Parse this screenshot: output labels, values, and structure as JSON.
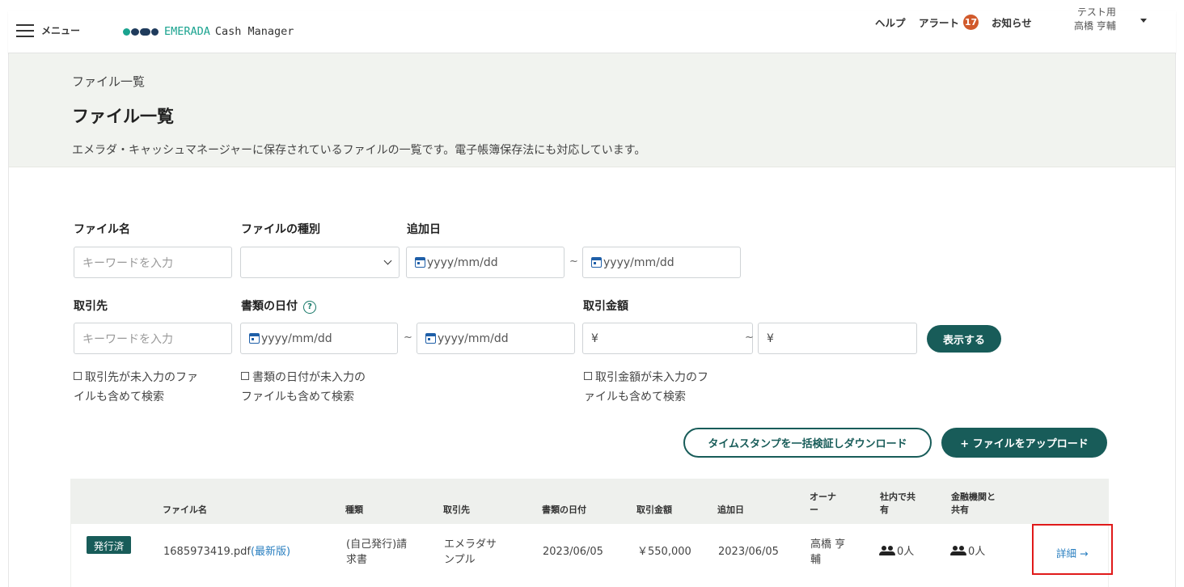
{
  "header": {
    "menu_label": "メニュー",
    "brand": "EMERADA",
    "product": "Cash Manager",
    "help": "ヘルプ",
    "alert": "アラート",
    "alert_count": "17",
    "news": "お知らせ",
    "user_org": "テスト用",
    "user_name": "高橋 亨輔"
  },
  "page": {
    "breadcrumb": "ファイル一覧",
    "title": "ファイル一覧",
    "description": "エメラダ・キャッシュマネージャーに保存されているファイルの一覧です。電子帳簿保存法にも対応しています。"
  },
  "filters": {
    "file_name_label": "ファイル名",
    "file_name_placeholder": "キーワードを入力",
    "file_type_label": "ファイルの種別",
    "added_date_label": "追加日",
    "date_placeholder": "yyyy/mm/dd",
    "tilde": "~",
    "partner_label": "取引先",
    "partner_placeholder": "キーワードを入力",
    "doc_date_label": "書類の日付",
    "help_symbol": "?",
    "amount_label": "取引金額",
    "yen": "¥",
    "show_button": "表示する",
    "chk_partner_line1": "取引先が未入力のファ",
    "chk_partner_line2": "イルも含めて検索",
    "chk_docdate_line1": "書類の日付が未入力の",
    "chk_docdate_line2": "ファイルも含めて検索",
    "chk_amount_line1": "取引金額が未入力のフ",
    "chk_amount_line2": "ァイルも含めて検索"
  },
  "actions": {
    "verify_download": "タイムスタンプを一括検証しダウンロード",
    "upload": "+ ファイルをアップロード"
  },
  "table": {
    "headers": {
      "file_name": "ファイル名",
      "type": "種類",
      "partner": "取引先",
      "doc_date": "書類の日付",
      "amount": "取引金額",
      "added": "追加日",
      "owner_l1": "オーナ",
      "owner_l2": "ー",
      "internal_l1": "社内で共",
      "internal_l2": "有",
      "bank_l1": "金融機関と",
      "bank_l2": "共有"
    },
    "rows": [
      {
        "status": "発行済",
        "file_name": "1685973419.pdf",
        "latest": "(最新版)",
        "type_l1": "(自己発行)請",
        "type_l2": "求書",
        "partner_l1": "エメラダサ",
        "partner_l2": "ンプル",
        "doc_date": "2023/06/05",
        "amount": "￥550,000",
        "added": "2023/06/05",
        "owner_l1": "高橋 亨",
        "owner_l2": "輔",
        "internal": "0人",
        "bank": "0人",
        "detail": "詳細 →"
      }
    ]
  }
}
